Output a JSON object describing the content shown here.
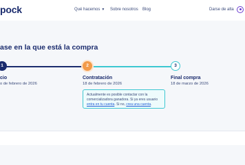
{
  "header": {
    "logo_text": "pock",
    "nav": {
      "what_we_do": "Qué hacemos",
      "about_us": "Sobre nosotros",
      "blog": "Blog"
    },
    "signup": "Darse de alta"
  },
  "phase": {
    "title": "ase en la que está la compra"
  },
  "steps": [
    {
      "number": "1",
      "label": "cio",
      "date": "o de febrero de 2026"
    },
    {
      "number": "2",
      "label": "Contratación",
      "date": "18 de febrero de 2026"
    },
    {
      "number": "3",
      "label": "Final compra",
      "date": "18 de marzo de 2026"
    }
  ],
  "info_box": {
    "text_1": "Actualmente es posible contactar con la comercializadora ganadora. Si ya eres usuario ",
    "link_login": "entra en tu cuenta",
    "text_2": ". Si no, ",
    "link_create": "crea una cuenta",
    "text_3": "."
  },
  "colors": {
    "primary": "#1a2b6d",
    "accent_orange": "#f29a4a",
    "accent_teal": "#3cc7d1",
    "user_icon": "#6b3bd1"
  }
}
